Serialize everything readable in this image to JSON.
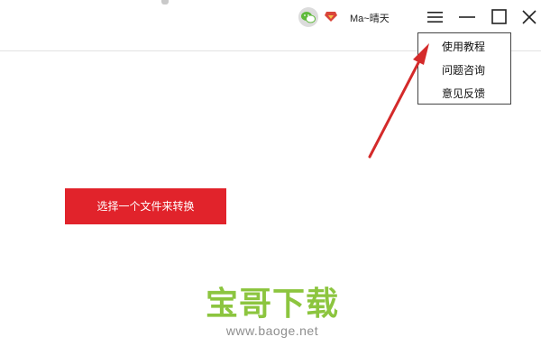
{
  "header": {
    "username": "Ma~晴天",
    "icons": {
      "wechat": "wechat-icon",
      "vip": "vip-diamond-icon",
      "menu": "hamburger-menu-icon",
      "minimize": "minimize-icon",
      "maximize": "maximize-icon",
      "close": "close-icon"
    }
  },
  "menu": {
    "items": [
      {
        "label": "使用教程"
      },
      {
        "label": "问题咨询"
      },
      {
        "label": "意见反馈"
      }
    ]
  },
  "main": {
    "select_file_label": "选择一个文件来转换"
  },
  "watermark": {
    "title": "宝哥下载",
    "url": "www.baoge.net"
  },
  "colors": {
    "accent": "#e1232b",
    "watermark_green": "#8cc53f",
    "watermark_gray": "#8e8e8e",
    "annotation_arrow": "#d42a2a"
  }
}
